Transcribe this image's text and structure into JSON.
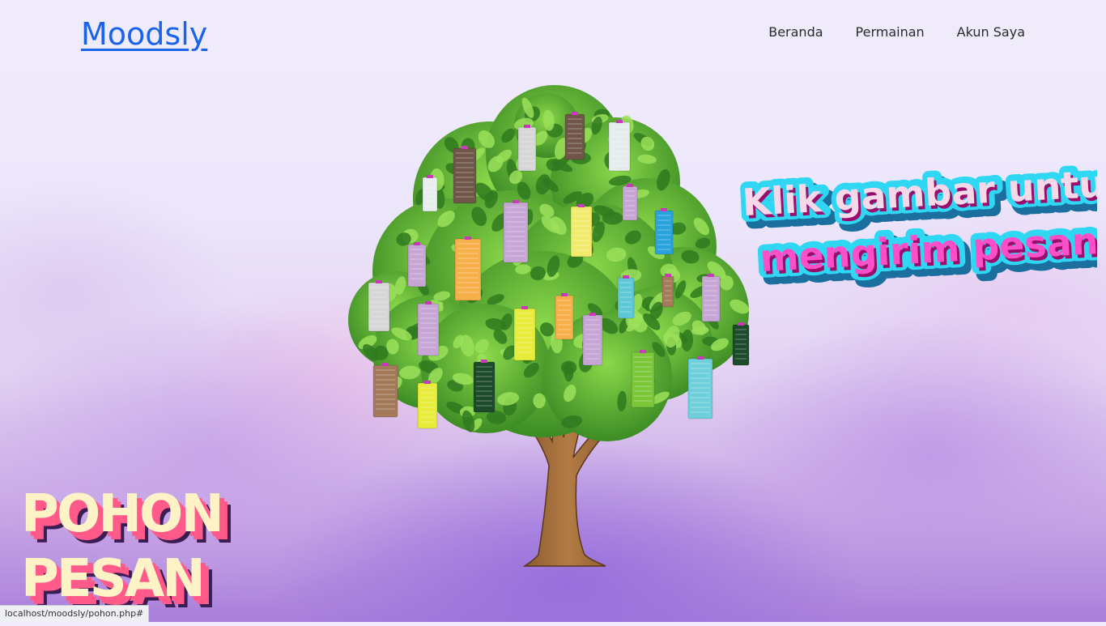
{
  "navbar": {
    "brand": "Moodsly",
    "links": [
      {
        "label": "Beranda"
      },
      {
        "label": "Permainan"
      },
      {
        "label": "Akun Saya"
      }
    ]
  },
  "cta": {
    "line1": "Klik gambar untuk",
    "line2": "mengirim pesan!"
  },
  "title": {
    "line1": "POHON",
    "line2": "PESAN"
  },
  "status_bar": {
    "url": "localhost/moodsly/pohon.php#"
  },
  "colors": {
    "brand": "#1a64ea",
    "leaf_dark": "#3f8f26",
    "leaf_light": "#7ccf3c",
    "trunk": "#8b5a2b",
    "cta_fill": "#ff4fc8",
    "cta_outline": "#2fd7f2",
    "title_fill": "#fdf3c7",
    "title_shadow": "#ff5a8a"
  },
  "message_tags": [
    {
      "color": "#6f5648"
    },
    {
      "color": "#d6d6d6"
    },
    {
      "color": "#6f5648"
    },
    {
      "color": "#e6ecec"
    },
    {
      "color": "#e8edf0"
    },
    {
      "color": "#c7a6d6"
    },
    {
      "color": "#c7a6d6"
    },
    {
      "color": "#f2ea6a"
    },
    {
      "color": "#c7a6d6"
    },
    {
      "color": "#2aa3dc"
    },
    {
      "color": "#f6b04a"
    },
    {
      "color": "#2aa3dc"
    },
    {
      "color": "#d6d6d6"
    },
    {
      "color": "#c7a6d6"
    },
    {
      "color": "#e7ec3a"
    },
    {
      "color": "#f6b04a"
    },
    {
      "color": "#c7a6d6"
    },
    {
      "color": "#5ec8d6"
    },
    {
      "color": "#a37a5a"
    },
    {
      "color": "#c7a6d6"
    },
    {
      "color": "#1d4a2c"
    },
    {
      "color": "#a37a5a"
    },
    {
      "color": "#e7ec3a"
    },
    {
      "color": "#1d4a2c"
    },
    {
      "color": "#7cc63a"
    },
    {
      "color": "#6fd0dc"
    }
  ]
}
